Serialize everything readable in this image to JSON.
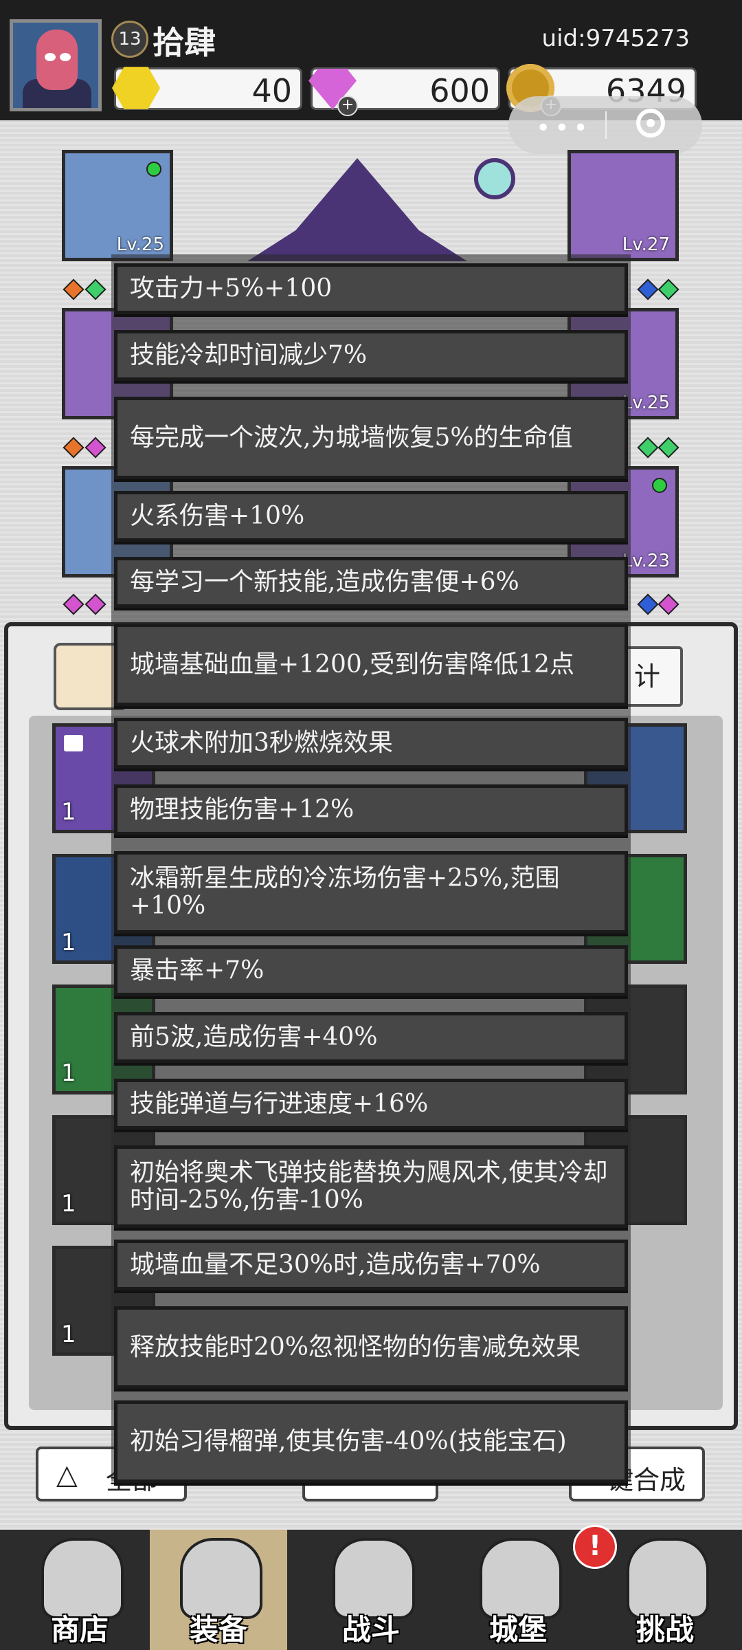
{
  "player": {
    "level": "13",
    "name": "拾肆",
    "uid": "uid:9745273"
  },
  "currencies": [
    {
      "icon": "gold-hexagon-icon",
      "amount": "40"
    },
    {
      "icon": "purple-gem-icon",
      "amount": "600"
    },
    {
      "icon": "gold-coin-icon",
      "amount": "6349"
    }
  ],
  "equipment_slots": [
    {
      "level": "Lv.25"
    },
    {
      "level": "Lv.27"
    },
    {
      "level": "Lv.25"
    },
    {
      "level": "Lv.23"
    }
  ],
  "panel": {
    "right_tab_label": "计"
  },
  "inventory_counts": [
    "1",
    "1",
    "1",
    "1",
    "1"
  ],
  "bottom_buttons": {
    "sort_label": "全部",
    "merge_label": "键合成"
  },
  "effects": [
    "攻击力+5%+100",
    "技能冷却时间减少7%",
    "每完成一个波次,为城墙恢复5%的生命值",
    "火系伤害+10%",
    "每学习一个新技能,造成伤害便+6%",
    "城墙基础血量+1200,受到伤害降低12点",
    "火球术附加3秒燃烧效果",
    "物理技能伤害+12%",
    "冰霜新星生成的冷冻场伤害+25%,范围+10%",
    "暴击率+7%",
    "前5波,造成伤害+40%",
    "技能弹道与行进速度+16%",
    "初始将奥术飞弹技能替换为飓风术,使其冷却时间-25%,伤害-10%",
    "城墙血量不足30%时,造成伤害+70%",
    "释放技能时20%忽视怪物的伤害减免效果",
    "初始习得榴弹,使其伤害-40%(技能宝石)"
  ],
  "nav": [
    {
      "label": "商店",
      "icon": "shop-icon",
      "active": false
    },
    {
      "label": "装备",
      "icon": "backpack-icon",
      "active": true
    },
    {
      "label": "战斗",
      "icon": "crossed-swords-icon",
      "active": false
    },
    {
      "label": "城堡",
      "icon": "castle-icon",
      "active": false
    },
    {
      "label": "挑战",
      "icon": "shield-icon",
      "active": false
    }
  ],
  "notification_badge": "!"
}
